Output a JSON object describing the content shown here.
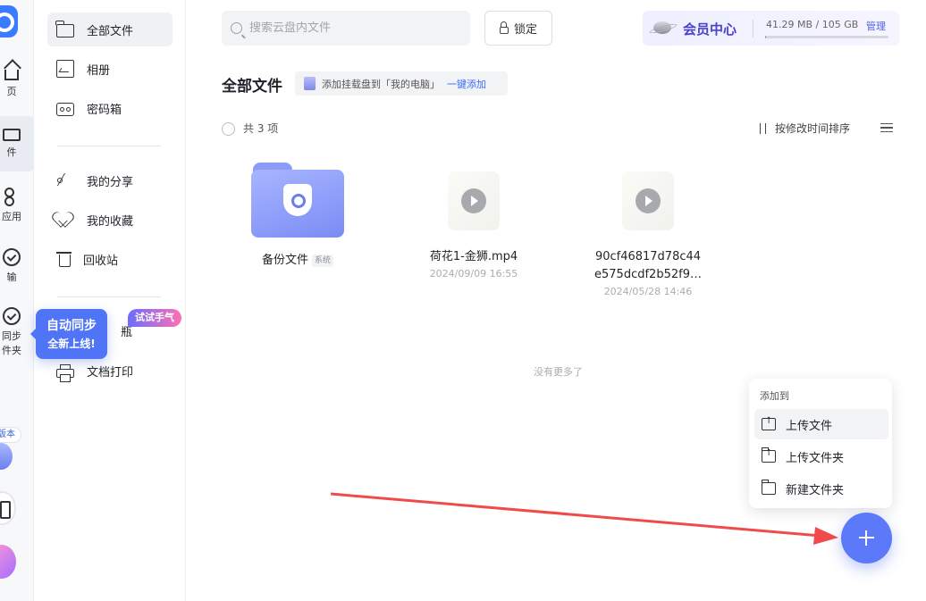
{
  "rail": {
    "items": [
      {
        "label": "页"
      },
      {
        "label": "件"
      },
      {
        "label": "应用"
      },
      {
        "label": "输"
      },
      {
        "label": "同步"
      },
      {
        "label": "件夹"
      }
    ],
    "badge": "版本"
  },
  "sidebar": {
    "items": [
      {
        "label": "全部文件",
        "icon": "folder-icon"
      },
      {
        "label": "相册",
        "icon": "album-icon"
      },
      {
        "label": "密码箱",
        "icon": "safe-icon"
      },
      {
        "label": "我的分享",
        "icon": "share-icon"
      },
      {
        "label": "我的收藏",
        "icon": "heart-icon"
      },
      {
        "label": "回收站",
        "icon": "trash-icon"
      },
      {
        "label": "瓶",
        "icon": "bottle-icon"
      },
      {
        "label": "文档打印",
        "icon": "printer-icon"
      }
    ],
    "sync_tip": {
      "line1": "自动同步",
      "line2": "全新上线!"
    },
    "try_badge": "试试手气"
  },
  "topbar": {
    "search_placeholder": "搜索云盘内文件",
    "lock_label": "锁定",
    "member_title": "会员中心",
    "storage_text": "41.29 MB / 105 GB",
    "storage_used_fraction": 0.0004,
    "manage_label": "管理"
  },
  "heading": {
    "title": "全部文件",
    "mount_text": "添加挂载盘到「我的电脑」",
    "mount_link": "一键添加"
  },
  "list": {
    "count_label": "共 3 项",
    "sort_label": "按修改时间排序",
    "no_more": "没有更多了",
    "files": [
      {
        "name": "备份文件",
        "tag": "系统",
        "date": "",
        "type": "folder"
      },
      {
        "name": "荷花1-金狮.mp4",
        "date": "2024/09/09 16:55",
        "type": "video"
      },
      {
        "name": "90cf46817d78c44\ne575dcdf2b52f9…",
        "date": "2024/05/28 14:46",
        "type": "video"
      }
    ]
  },
  "popover": {
    "title": "添加到",
    "items": [
      {
        "label": "上传文件"
      },
      {
        "label": "上传文件夹"
      },
      {
        "label": "新建文件夹"
      }
    ]
  },
  "colors": {
    "accent": "#5b79f8",
    "member": "#4a3fd1",
    "annotation_arrow": "#f04a4a"
  }
}
